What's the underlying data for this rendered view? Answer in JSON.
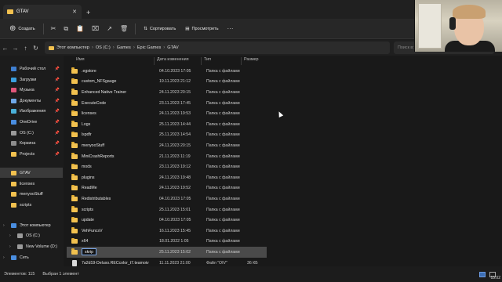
{
  "window": {
    "tab_title": "GTAV",
    "close_glyph": "✕",
    "new_tab_glyph": "+",
    "min_glyph": "—",
    "max_glyph": "☐",
    "close_window_glyph": "✕"
  },
  "toolbar": {
    "create_label": "Создать",
    "sort_label": "Сортировать",
    "view_label": "Просмотреть",
    "more_glyph": "···",
    "cut_glyph": "✂",
    "copy_glyph": "⧉",
    "paste_glyph": "📋",
    "rename_glyph": "⌧",
    "share_glyph": "↗",
    "delete_glyph": "🗑",
    "create_glyph": "⊕",
    "sort_glyph": "⇅",
    "view_glyph": "▤"
  },
  "address": {
    "back_glyph": "←",
    "forward_glyph": "→",
    "up_glyph": "↑",
    "refresh_glyph": "↻",
    "crumbs": [
      "Этот компьютер",
      "OS (C:)",
      "Games",
      "Epic Games",
      "GTAV"
    ],
    "separator": "›",
    "search_placeholder": "Поиск в: GTAV"
  },
  "columns": {
    "name": "Имя",
    "date": "Дата изменения",
    "type": "Тип",
    "size": "Размер"
  },
  "sidebar": {
    "items": [
      {
        "label": "Рабочий стол",
        "color": "#3f7fd0"
      },
      {
        "label": "Загрузки",
        "color": "#3aa0e0"
      },
      {
        "label": "Музыка",
        "color": "#e0567a"
      },
      {
        "label": "Документы",
        "color": "#6fa8e8"
      },
      {
        "label": "Изображения",
        "color": "#4ab0d8"
      },
      {
        "label": "OneDrive",
        "color": "#4a8ee0"
      },
      {
        "label": "OS (C:)",
        "color": "#9a9a9a"
      },
      {
        "label": "Корзина",
        "color": "#8c8c8c"
      },
      {
        "label": "Projects",
        "color": "#f2c14f"
      },
      {
        "label": "GTAV",
        "color": "#f2c14f"
      },
      {
        "label": "licenses",
        "color": "#f2c14f"
      },
      {
        "label": "menyooStuff",
        "color": "#f2c14f"
      },
      {
        "label": "scripts",
        "color": "#f2c14f"
      },
      {
        "label": "Этот компьютер",
        "color": "#4a8ee0"
      },
      {
        "label": "OS (C:)",
        "color": "#9a9a9a"
      },
      {
        "label": "New Volume (D:)",
        "color": "#9a9a9a"
      },
      {
        "label": "Сеть",
        "color": "#4a8ee0"
      }
    ]
  },
  "files": [
    {
      "name": ".egstore",
      "date": "04.10.2023 17:05",
      "type": "Папка с файлами",
      "size": ""
    },
    {
      "name": "custom_NFSgauge",
      "date": "19.11.2023 21:12",
      "type": "Папка с файлами",
      "size": ""
    },
    {
      "name": "Enhanced Native Trainer",
      "date": "24.11.2023 20:15",
      "type": "Папка с файлами",
      "size": ""
    },
    {
      "name": "ExecuteCode",
      "date": "23.11.2023 17:45",
      "type": "Папка с файлами",
      "size": ""
    },
    {
      "name": "licenses",
      "date": "24.11.2023 19:53",
      "type": "Папка с файлами",
      "size": ""
    },
    {
      "name": "Logs",
      "date": "25.11.2023 14:44",
      "type": "Папка с файлами",
      "size": ""
    },
    {
      "name": "lspdfr",
      "date": "25.11.2023 14:54",
      "type": "Папка с файлами",
      "size": ""
    },
    {
      "name": "menyooStuff",
      "date": "24.11.2023 20:15",
      "type": "Папка с файлами",
      "size": ""
    },
    {
      "name": "MiniCrashReports",
      "date": "21.11.2023 11:19",
      "type": "Папка с файлами",
      "size": ""
    },
    {
      "name": "mods",
      "date": "23.11.2023 19:12",
      "type": "Папка с файлами",
      "size": ""
    },
    {
      "name": "plugins",
      "date": "24.11.2023 19:48",
      "type": "Папка с файлами",
      "size": ""
    },
    {
      "name": "ReadMe",
      "date": "24.11.2023 19:52",
      "type": "Папка с файлами",
      "size": ""
    },
    {
      "name": "Redistributables",
      "date": "04.10.2023 17:05",
      "type": "Папка с файлами",
      "size": ""
    },
    {
      "name": "scripts",
      "date": "25.11.2023 15:01",
      "type": "Папка с файлами",
      "size": ""
    },
    {
      "name": "update",
      "date": "04.10.2023 17:05",
      "type": "Папка с файлами",
      "size": ""
    },
    {
      "name": "VehFuncsV",
      "date": "16.11.2023 15:45",
      "type": "Папка с файлами",
      "size": ""
    },
    {
      "name": "x64",
      "date": "18.01.2022 1:05",
      "type": "Папка с файлами",
      "size": ""
    },
    {
      "name": "skrip",
      "date": "25.11.2023 15:02",
      "type": "Папка с файлами",
      "size": "",
      "selected": true,
      "renaming": true
    },
    {
      "name": "7a2d19-Deluxo.RECcolor_t7.teamoiv",
      "date": "11.11.2023 21:00",
      "type": "Файл \"OIV\"",
      "size": "36 КБ",
      "is_file": true
    }
  ],
  "status": {
    "count": "Элементов: 115",
    "selected": "Выбран 1 элемент"
  },
  "clock": "15:02"
}
